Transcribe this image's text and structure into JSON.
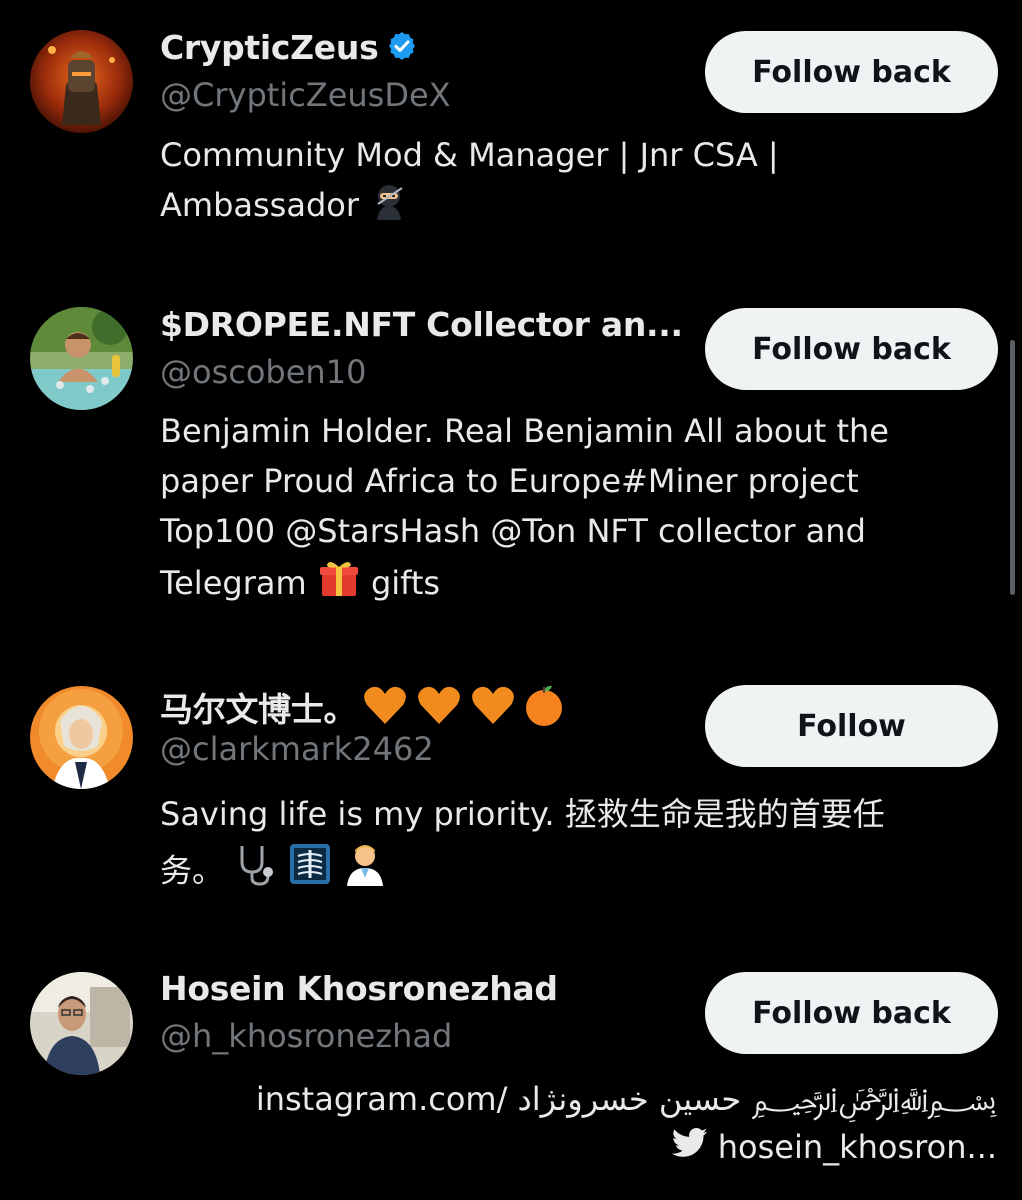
{
  "accounts": [
    {
      "name": "CrypticZeus",
      "verified": true,
      "handle": "@CrypticZeusDeX",
      "button_label": "Follow back",
      "bio_line1": "Community Mod & Manager | Jnr CSA |",
      "bio_line2": "Ambassador",
      "bio_emoji": "ninja-icon"
    },
    {
      "name": "$DROPEE.NFT Collector an...",
      "verified": false,
      "handle": "@oscoben10",
      "button_label": "Follow back",
      "bio_line1": "Benjamin Holder. Real Benjamin All about the",
      "bio_line2": "paper Proud Africa to Europe#Miner project",
      "bio_line3": "Top100 @StarsHash @Ton NFT collector and",
      "bio_line4_pre": "Telegram",
      "bio_line4_post": "gifts",
      "bio_emoji": "gift-icon"
    },
    {
      "name": "马尔文博士。",
      "name_emojis": [
        "orange-heart-icon",
        "orange-heart-icon",
        "orange-heart-icon",
        "tangerine-icon"
      ],
      "verified": false,
      "handle": "@clarkmark2462",
      "button_label": "Follow",
      "bio_line1": "Saving life is my priority. 拯救生命是我的首要任",
      "bio_line2": "务。",
      "bio_emojis": [
        "stethoscope-icon",
        "xray-icon",
        "health-worker-icon"
      ]
    },
    {
      "name": "Hosein Khosronezhad",
      "verified": false,
      "handle": "@h_khosronezhad",
      "button_label": "Follow back",
      "bio_line1": "instagram.com/ حسين خسرونژاد ﷽",
      "bio_line2": "hosein_khosron...",
      "bio_line2_icon": "twitter-bird-icon"
    }
  ],
  "colors": {
    "background": "#000000",
    "primary_text": "#e7e9ea",
    "secondary_text": "#71767b",
    "button_bg": "#eff3f4",
    "button_text": "#0f1419",
    "verified_blue": "#1d9bf0"
  }
}
